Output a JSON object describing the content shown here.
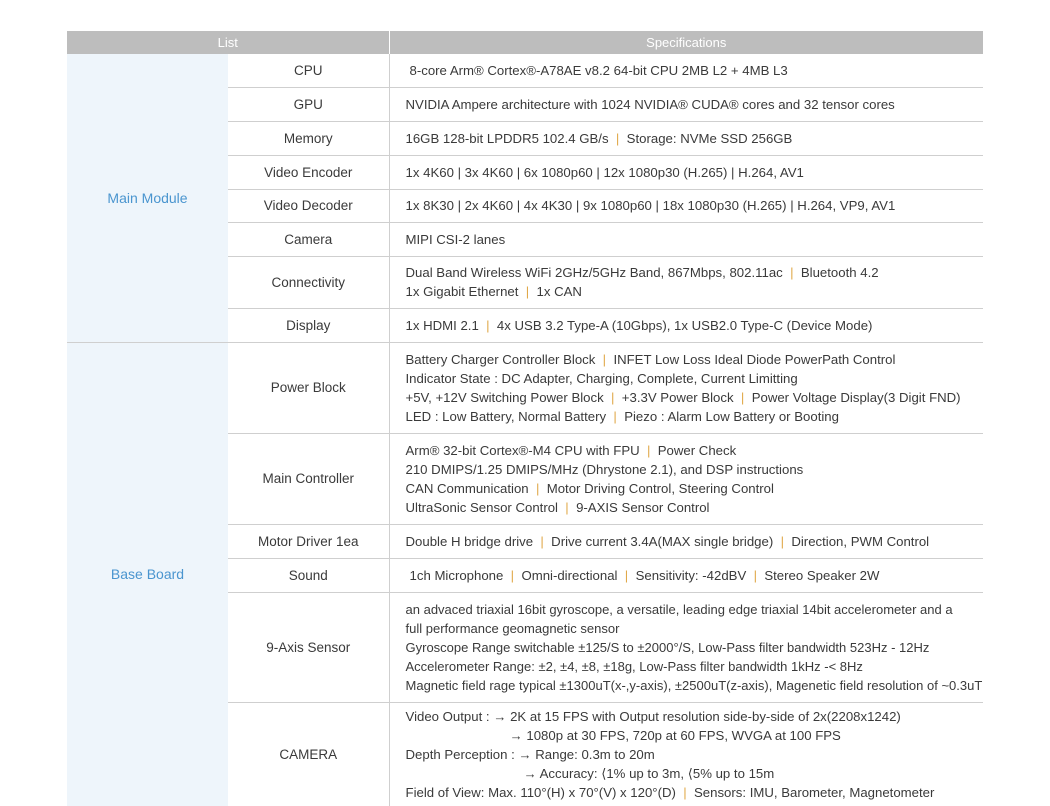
{
  "header": {
    "list": "List",
    "specifications": "Specifications"
  },
  "main_module": {
    "label": "Main Module",
    "rows": [
      {
        "item": "CPU",
        "lines": [
          [
            "8-core Arm® Cortex®-A78AE v8.2 64-bit CPU 2MB L2 + 4MB L3"
          ]
        ]
      },
      {
        "item": "GPU",
        "lines": [
          [
            "NVIDIA Ampere architecture with 1024 NVIDIA® CUDA® cores and 32 tensor cores"
          ]
        ]
      },
      {
        "item": "Memory",
        "lines": [
          [
            "16GB 128-bit LPDDR5 102.4 GB/s",
            "Storage: NVMe SSD 256GB"
          ]
        ]
      },
      {
        "item": "Video Encoder",
        "lines": [
          [
            "1x 4K60 | 3x 4K60 | 6x 1080p60 | 12x 1080p30 (H.265) | H.264, AV1"
          ]
        ]
      },
      {
        "item": "Video Decoder",
        "lines": [
          [
            "1x 8K30 | 2x 4K60 | 4x 4K30 | 9x 1080p60 | 18x 1080p30 (H.265) | H.264, VP9, AV1"
          ]
        ]
      },
      {
        "item": "Camera",
        "lines": [
          [
            "MIPI CSI-2 lanes"
          ]
        ]
      },
      {
        "item": "Connectivity",
        "lines": [
          [
            "Dual Band Wireless WiFi 2GHz/5GHz Band, 867Mbps, 802.11ac",
            "Bluetooth 4.2"
          ],
          [
            "1x Gigabit Ethernet",
            "1x CAN"
          ]
        ]
      },
      {
        "item": "Display",
        "lines": [
          [
            "1x HDMI 2.1",
            "4x USB 3.2 Type-A (10Gbps), 1x USB2.0 Type-C (Device Mode)"
          ]
        ]
      }
    ]
  },
  "base_board": {
    "label": "Base Board",
    "rows": [
      {
        "item": "Power Block",
        "lines": [
          [
            "Battery Charger Controller Block",
            "INFET Low Loss Ideal Diode PowerPath Control"
          ],
          [
            "Indicator State : DC Adapter, Charging, Complete, Current Limitting"
          ],
          [
            "+5V, +12V Switching Power Block",
            "+3.3V Power Block",
            "Power Voltage Display(3 Digit FND)"
          ],
          [
            "LED : Low Battery, Normal Battery",
            "Piezo : Alarm Low Battery or Booting"
          ]
        ]
      },
      {
        "item": "Main Controller",
        "lines": [
          [
            "Arm® 32-bit Cortex®-M4 CPU with FPU",
            "Power Check"
          ],
          [
            "210 DMIPS/1.25 DMIPS/MHz (Dhrystone 2.1), and DSP instructions"
          ],
          [
            "CAN Communication",
            "Motor Driving Control, Steering Control"
          ],
          [
            "UltraSonic Sensor Control",
            "9-AXIS Sensor Control"
          ]
        ]
      },
      {
        "item": "Motor Driver 1ea",
        "lines": [
          [
            "Double H bridge drive",
            "Drive current 3.4A(MAX single bridge)",
            "Direction, PWM Control"
          ]
        ]
      },
      {
        "item": "Sound",
        "lines": [
          [
            "1ch Microphone",
            "Omni-directional",
            "Sensitivity: -42dBV",
            "Stereo Speaker 2W"
          ]
        ]
      },
      {
        "item": "9-Axis Sensor",
        "lines": [
          [
            "an advaced triaxial 16bit gyroscope, a versatile, leading edge triaxial 14bit accelerometer and a"
          ],
          [
            "full performance geomagnetic sensor"
          ],
          [
            "Gyroscope Range switchable ±125/S to ±2000°/S, Low-Pass filter bandwidth 523Hz - 12Hz"
          ],
          [
            "Accelerometer Range: ±2, ±4, ±8, ±18g, Low-Pass filter bandwidth 1kHz -< 8Hz"
          ],
          [
            "Magnetic field rage typical ±1300uT(x-,y-axis), ±2500uT(z-axis), Magenetic field resolution of ~0.3uT"
          ]
        ]
      },
      {
        "item": "CAMERA",
        "lines": [
          [
            "Video Output : → 2K at 15 FPS with Output resolution side-by-side of 2x(2208x1242)"
          ],
          [
            "→ 1080p at 30 FPS, 720p at 60 FPS, WVGA at 100 FPS"
          ],
          [
            "Depth Perception : → Range: 0.3m to 20m"
          ],
          [
            "→ Accuracy: ⟨1% up to 3m, ⟨5% up to 15m"
          ],
          [
            "Field of View: Max. 110°(H) x 70°(V) x 120°(D)",
            "Sensors: IMU, Barometer, Magnetometer"
          ]
        ]
      }
    ]
  },
  "colors": {
    "header_bg": "#bdbdbd",
    "group_bg": "#eef5fb",
    "group_text": "#4a95cf",
    "separator": "#e0a94a",
    "rule": "#cfcfcf"
  }
}
